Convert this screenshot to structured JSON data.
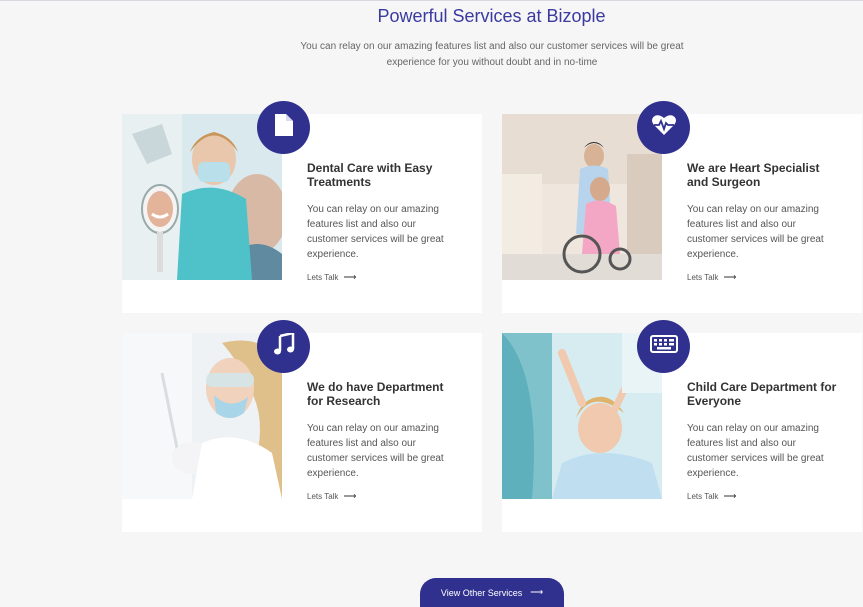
{
  "header": {
    "title": "Powerful Services at Bizople",
    "subtitle": "You can relay on our amazing features list and also our customer services will be great experience for you without doubt and in no-time"
  },
  "colors": {
    "accent": "#30318e",
    "title": "#3a3aa0",
    "background": "#f6f6f6"
  },
  "services": [
    {
      "icon": "document-icon",
      "title": "Dental Care with Easy Treatments",
      "text": "You can relay on our amazing features list and also our customer services will be great experience.",
      "link": "Lets Talk"
    },
    {
      "icon": "heartbeat-icon",
      "title": "We are Heart Specialist and Surgeon",
      "text": "You can relay on our amazing features list and also our customer services will be great experience.",
      "link": "Lets Talk"
    },
    {
      "icon": "music-note-icon",
      "title": "We do have Department for Research",
      "text": "You can relay on our amazing features list and also our customer services will be great experience.",
      "link": "Lets Talk"
    },
    {
      "icon": "keyboard-icon",
      "title": "Child Care Department for Everyone",
      "text": "You can relay on our amazing features list and also our customer services will be great experience.",
      "link": "Lets Talk"
    }
  ],
  "footer": {
    "button_label": "View Other Services"
  }
}
